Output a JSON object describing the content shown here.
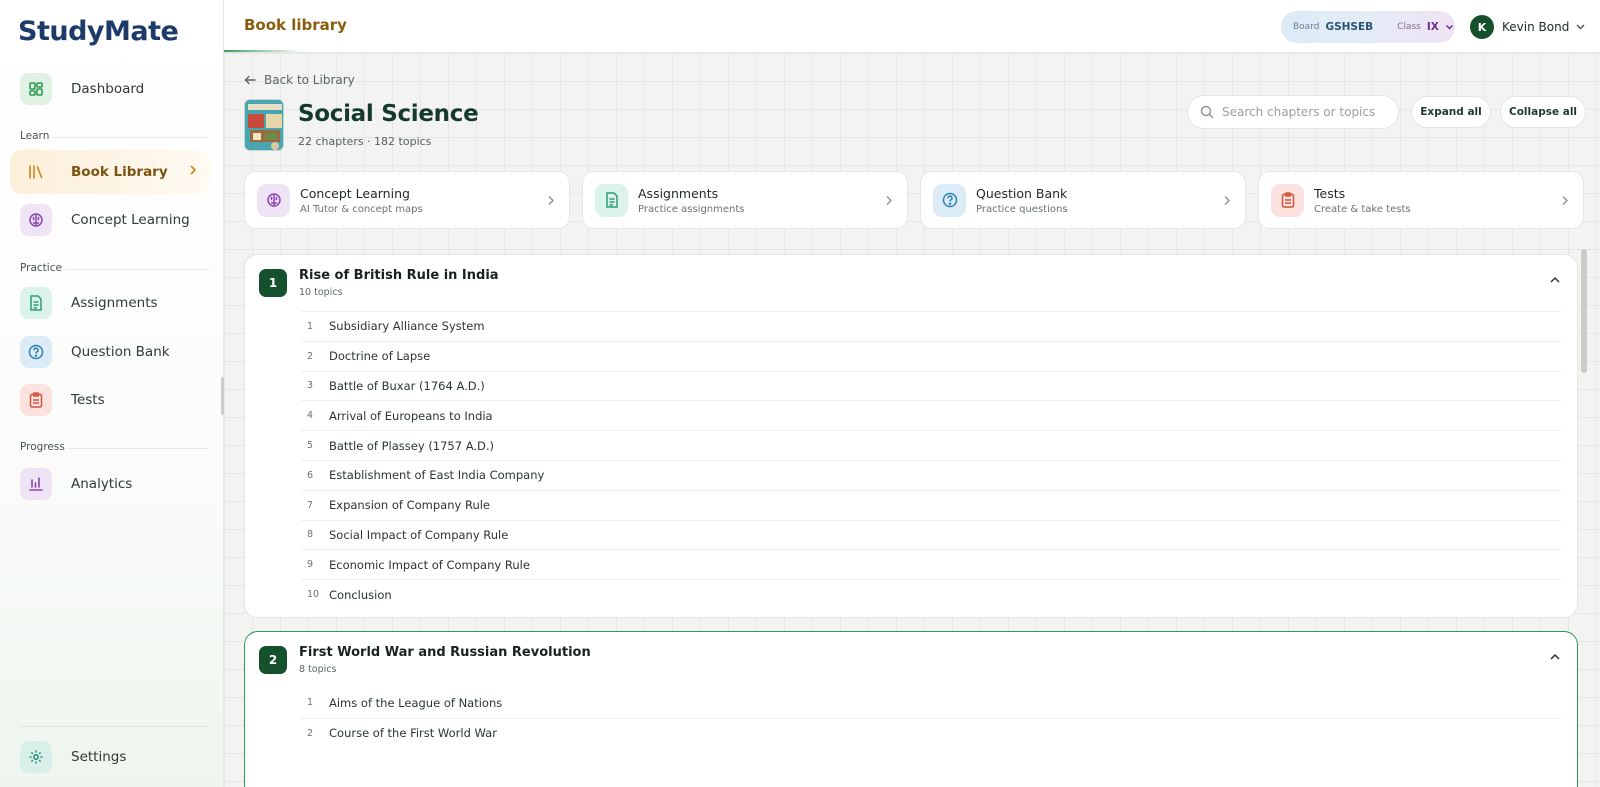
{
  "brand": {
    "name_a": "Study",
    "name_b": "Mate"
  },
  "sidebar": {
    "dashboard": "Dashboard",
    "sections": {
      "learn": "Learn",
      "practice": "Practice",
      "progress": "Progress"
    },
    "book_library": "Book Library",
    "concept_learning": "Concept Learning",
    "assignments": "Assignments",
    "question_bank": "Question Bank",
    "tests": "Tests",
    "analytics": "Analytics",
    "settings": "Settings"
  },
  "topbar": {
    "title": "Book library",
    "board_label": "Board",
    "board_value": "GSHSEB",
    "class_label": "Class",
    "class_value": "IX",
    "user_initial": "K",
    "user_name": "Kevin Bond"
  },
  "page": {
    "back_label": "Back to Library",
    "subject": "Social Science",
    "meta": "22 chapters · 182 topics",
    "search_placeholder": "Search chapters or topics",
    "expand_all": "Expand all",
    "collapse_all": "Collapse all"
  },
  "quick_cards": [
    {
      "title": "Concept Learning",
      "sub": "AI Tutor & concept maps"
    },
    {
      "title": "Assignments",
      "sub": "Practice assignments"
    },
    {
      "title": "Question Bank",
      "sub": "Practice questions"
    },
    {
      "title": "Tests",
      "sub": "Create & take tests"
    }
  ],
  "chapters": [
    {
      "num": "1",
      "title": "Rise of British Rule in India",
      "count": "10 topics",
      "topics": [
        {
          "num": "1",
          "title": "Subsidiary Alliance System"
        },
        {
          "num": "2",
          "title": "Doctrine of Lapse"
        },
        {
          "num": "3",
          "title": "Battle of Buxar (1764 A.D.)"
        },
        {
          "num": "4",
          "title": "Arrival of Europeans to India"
        },
        {
          "num": "5",
          "title": "Battle of Plassey (1757 A.D.)"
        },
        {
          "num": "6",
          "title": "Establishment of East India Company"
        },
        {
          "num": "7",
          "title": "Expansion of Company Rule"
        },
        {
          "num": "8",
          "title": "Social Impact of Company Rule"
        },
        {
          "num": "9",
          "title": "Economic Impact of Company Rule"
        },
        {
          "num": "10",
          "title": "Conclusion"
        }
      ]
    },
    {
      "num": "2",
      "title": "First World War and Russian Revolution",
      "count": "8 topics",
      "topics": [
        {
          "num": "1",
          "title": "Aims of the League of Nations"
        },
        {
          "num": "2",
          "title": "Course of the First World War"
        }
      ]
    }
  ],
  "colors": {
    "brand_green": "#14512c",
    "accent_amber": "#8a5d0c",
    "highlight_border": "#2e9a4e"
  }
}
